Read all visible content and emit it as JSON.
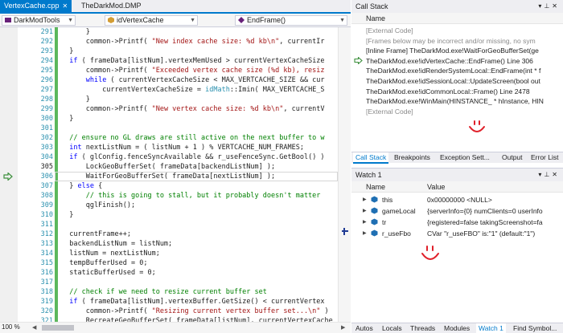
{
  "editor": {
    "tabs": [
      {
        "label": "VertexCache.cpp",
        "active": true
      },
      {
        "label": "TheDarkMod.DMP",
        "active": false
      }
    ],
    "nav": {
      "project": "DarkModTools",
      "scope": "idVertexCache",
      "member": "EndFrame()"
    },
    "zoom": "100 %",
    "line_numbers": [
      "291",
      "292",
      "293",
      "294",
      "295",
      "296",
      "297",
      "298",
      "299",
      "300",
      "301",
      "302",
      "303",
      "304",
      "305",
      "306",
      "307",
      "308",
      "309",
      "310",
      "311",
      "312",
      "313",
      "314",
      "315",
      "316",
      "317",
      "318",
      "319",
      "320",
      "321",
      "322"
    ],
    "current_line": "305"
  },
  "call_stack": {
    "title": "Call Stack",
    "col_name": "Name",
    "rows": [
      {
        "text": "[External Code]",
        "gray": true
      },
      {
        "text": "[Frames below may be incorrect and/or missing, no sym",
        "gray": true
      },
      {
        "text": "[Inline Frame] TheDarkMod.exe!WaitForGeoBufferSet(ge",
        "gray": false
      },
      {
        "text": "TheDarkMod.exe!idVertexCache::EndFrame() Line 306",
        "gray": false
      },
      {
        "text": "TheDarkMod.exe!idRenderSystemLocal::EndFrame(int * f",
        "gray": false
      },
      {
        "text": "TheDarkMod.exe!idSessionLocal::UpdateScreen(bool out",
        "gray": false
      },
      {
        "text": "TheDarkMod.exe!idCommonLocal::Frame() Line 2478",
        "gray": false
      },
      {
        "text": "TheDarkMod.exe!WinMain(HINSTANCE_ * hInstance, HIN",
        "gray": false
      },
      {
        "text": "[External Code]",
        "gray": true
      }
    ],
    "tabs": [
      "Call Stack",
      "Breakpoints",
      "Exception Sett...",
      "Output",
      "Error List"
    ]
  },
  "watch": {
    "title": "Watch 1",
    "col_name": "Name",
    "col_value": "Value",
    "rows": [
      {
        "name": "this",
        "value": "0x00000000 <NULL>"
      },
      {
        "name": "gameLocal",
        "value": "{serverInfo={0} numClients=0 userInfo"
      },
      {
        "name": "tr",
        "value": "{registered=false takingScreenshot=fa"
      },
      {
        "name": "r_useFbo",
        "value": "CVar \"r_useFBO\" is:\"1\" (default:\"1\")"
      }
    ],
    "tabs": [
      "Autos",
      "Locals",
      "Threads",
      "Modules",
      "Watch 1",
      "Find Symbol..."
    ]
  },
  "colors": {
    "accent": "#007acc",
    "keyword": "#0000ff",
    "string": "#a31515",
    "comment": "#008000",
    "type": "#2b91af",
    "smiley": "#e0202a"
  }
}
